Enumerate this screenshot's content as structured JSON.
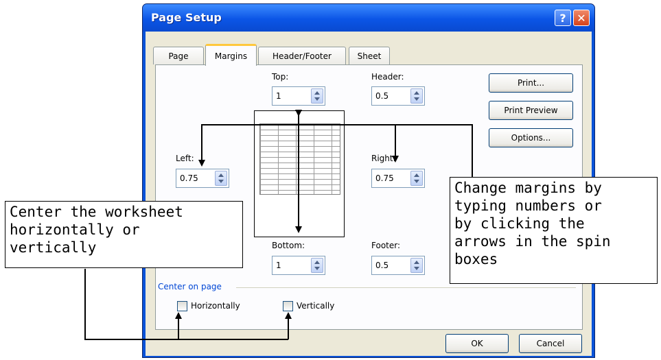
{
  "window": {
    "title": "Page Setup",
    "help_glyph": "?",
    "close_glyph": "✕"
  },
  "tabs": [
    {
      "label": "Page",
      "active": false
    },
    {
      "label": "Margins",
      "active": true
    },
    {
      "label": "Header/Footer",
      "active": false
    },
    {
      "label": "Sheet",
      "active": false
    }
  ],
  "margins": {
    "top": {
      "label": "Top:",
      "value": "1"
    },
    "header": {
      "label": "Header:",
      "value": "0.5"
    },
    "left": {
      "label": "Left:",
      "value": "0.75"
    },
    "right": {
      "label": "Right:",
      "value": "0.75"
    },
    "bottom": {
      "label": "Bottom:",
      "value": "1"
    },
    "footer": {
      "label": "Footer:",
      "value": "0.5"
    }
  },
  "buttons": {
    "print": "Print...",
    "print_preview": "Print Preview",
    "options": "Options...",
    "ok": "OK",
    "cancel": "Cancel"
  },
  "center_on_page": {
    "group_label": "Center on page",
    "horizontally": "Horizontally",
    "vertically": "Vertically"
  },
  "callouts": {
    "center": "Center the worksheet\nhorizontally or\nvertically",
    "margins": "Change margins by\ntyping numbers or\nby clicking the\narrows in the spin\nboxes"
  }
}
